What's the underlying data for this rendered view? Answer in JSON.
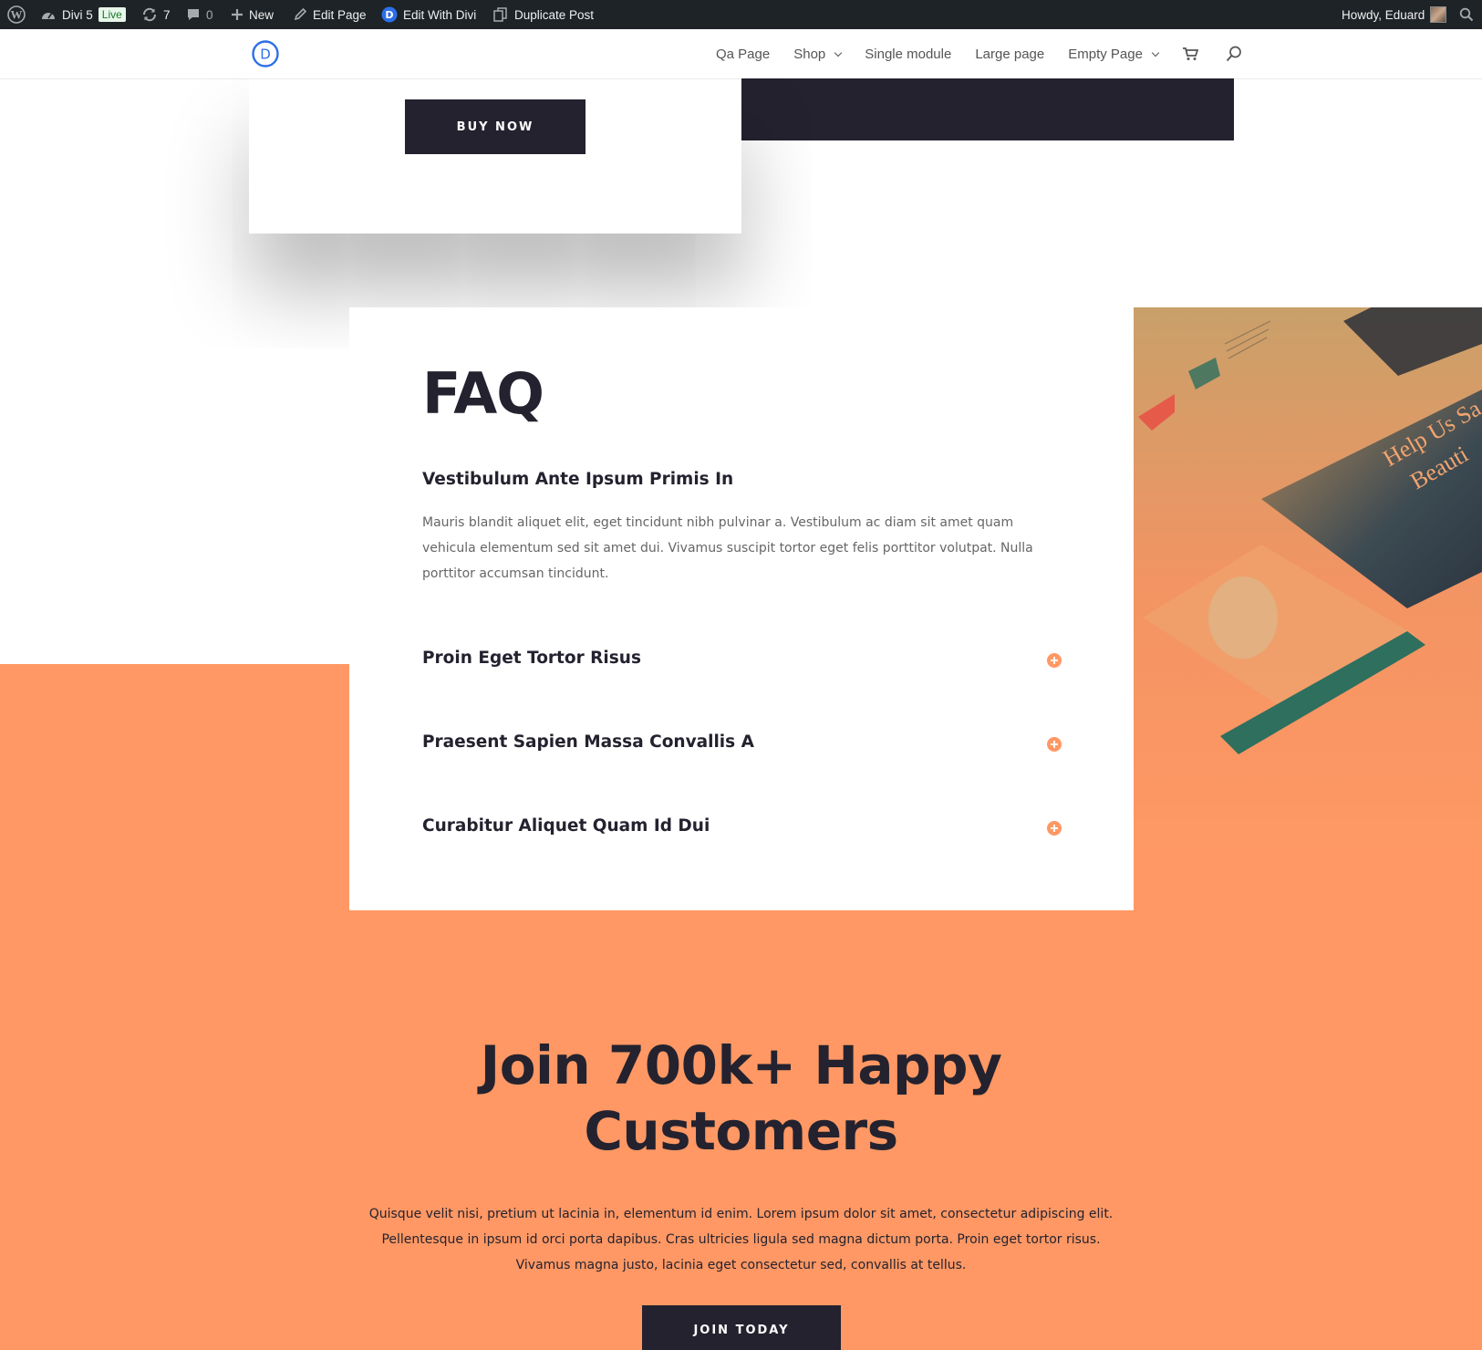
{
  "admin_bar": {
    "site_name": "Divi 5",
    "live_badge": "Live",
    "updates_count": "7",
    "comments_count": "0",
    "new_label": "New",
    "edit_page_label": "Edit Page",
    "edit_with_divi_label": "Edit With Divi",
    "duplicate_post_label": "Duplicate Post",
    "howdy_label": "Howdy, Eduard"
  },
  "header": {
    "logo_letter": "D",
    "nav": [
      "Qa Page",
      "Shop",
      "Single module",
      "Large page",
      "Empty Page"
    ]
  },
  "pricing": {
    "buy_now_label": "BUY NOW"
  },
  "faq": {
    "title": "FAQ",
    "open_question": "Vestibulum Ante Ipsum Primis In",
    "open_answer": "Mauris blandit aliquet elit, eget tincidunt nibh pulvinar a. Vestibulum ac diam sit amet quam vehicula elementum sed sit amet dui. Vivamus suscipit tortor eget felis porttitor volutpat. Nulla porttitor accumsan tincidunt.",
    "closed_questions": [
      "Proin Eget Tortor Risus",
      "Praesent Sapien Massa Convallis A",
      "Curabitur Aliquet Quam Id Dui"
    ]
  },
  "promo_image": {
    "headline_fragment_1": "Help Us Sa",
    "headline_fragment_2": "Beauti"
  },
  "cta": {
    "title_line1": "Join 700k+ Happy",
    "title_line2": "Customers",
    "text": "Quisque velit nisi, pretium ut lacinia in, elementum id enim. Lorem ipsum dolor sit amet, consectetur adipiscing elit. Pellentesque in ipsum id orci porta dapibus. Cras ultricies ligula sed magna dictum porta. Proin eget tortor risus. Vivamus magna justo, lacinia eget consectetur sed, convallis at tellus.",
    "button_label": "JOIN TODAY"
  },
  "colors": {
    "accent_orange": "#ff9864",
    "dark": "#24222f",
    "admin_bar_bg": "#1d2327",
    "divi_blue": "#2d6ee8"
  },
  "icons": [
    "wordpress-icon",
    "dashboard-icon",
    "updates-icon",
    "comments-icon",
    "plus-icon",
    "pencil-icon",
    "divi-logo-icon",
    "duplicate-icon",
    "search-icon",
    "cart-icon",
    "toggle-plus-icon"
  ]
}
